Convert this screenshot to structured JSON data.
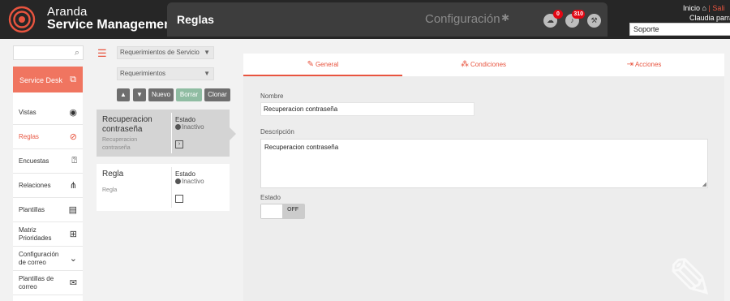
{
  "header": {
    "brand_line1": "Aranda",
    "brand_line2": "Service Management",
    "page_title": "Reglas",
    "config_label": "Configuración",
    "icons": [
      {
        "name": "cloud-download-icon",
        "glyph": "☁",
        "badge": "0"
      },
      {
        "name": "notification-bell-icon",
        "glyph": "🔔",
        "badge": "310"
      },
      {
        "name": "tools-icon",
        "glyph": "⚒",
        "badge": ""
      }
    ],
    "inicio": "Inicio",
    "salir": "Sali",
    "user_name": "Claudia parra",
    "profile": "Soporte",
    "colors": {
      "bar": "#262626",
      "panel": "#3d3d3d",
      "accent": "#e8543f",
      "badge": "#e30613"
    }
  },
  "sidebar": {
    "search_placeholder": "",
    "active_section": "Service Desk",
    "items": [
      {
        "label": "Vistas",
        "icon": "eye-icon",
        "glyph": "◉"
      },
      {
        "label": "Reglas",
        "icon": "compass-icon",
        "glyph": "⊘"
      },
      {
        "label": "Encuestas",
        "icon": "survey-icon",
        "glyph": "⍰"
      },
      {
        "label": "Relaciones",
        "icon": "relations-icon",
        "glyph": "⋔"
      },
      {
        "label": "Plantillas",
        "icon": "document-icon",
        "glyph": "▤"
      },
      {
        "label": "Matriz Prioridades",
        "icon": "table-icon",
        "glyph": "⊞"
      },
      {
        "label": "Configuración de correo",
        "icon": "chevron-down-icon",
        "glyph": "⌄"
      },
      {
        "label": "Plantillas de correo",
        "icon": "mail-icon",
        "glyph": "✉"
      }
    ]
  },
  "rules_column": {
    "filter_service": "Requerimientos de Servicio",
    "filter_type": "Requerimientos",
    "buttons": {
      "up": "▲",
      "down": "▼",
      "new": "Nuevo",
      "delete": "Borrar",
      "clone": "Clonar"
    },
    "rules": [
      {
        "name": "Recuperacion contraseña",
        "description": "Recuperacion contraseña",
        "estado_label": "Estado",
        "state": "Inactivo",
        "selected": true
      },
      {
        "name": "Regla",
        "description": "Regla",
        "estado_label": "Estado",
        "state": "Inactivo",
        "selected": false
      }
    ]
  },
  "detail": {
    "tabs": [
      {
        "label": "General",
        "icon": "edit-icon",
        "glyph": "✎",
        "active": true
      },
      {
        "label": "Condiciones",
        "icon": "conditions-icon",
        "glyph": "⁂",
        "active": false
      },
      {
        "label": "Acciones",
        "icon": "actions-icon",
        "glyph": "⇥",
        "active": false
      }
    ],
    "name_label": "Nombre",
    "name_value": "Recuperacion contraseña",
    "description_label": "Descripción",
    "description_value": "Recuperacion contraseña",
    "estado_label": "Estado",
    "toggle_text": "OFF",
    "toggle_on": false
  }
}
